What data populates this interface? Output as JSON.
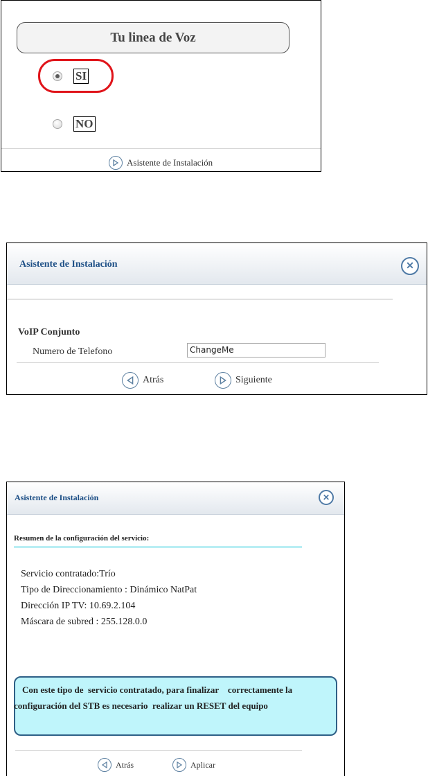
{
  "panel1": {
    "title": "Tu linea de Voz",
    "options": [
      {
        "label": "SI",
        "selected": true
      },
      {
        "label": "NO",
        "selected": false
      }
    ],
    "footer_link": "Asistente de Instalación",
    "highlight_color": "#e0141a"
  },
  "panel2": {
    "title": "Asistente de Instalación",
    "section": "VoIP Conjunto",
    "phone_label": "Numero de Telefono",
    "phone_value": "ChangeMe",
    "back_label": "Atrás",
    "next_label": "Siguiente"
  },
  "panel3": {
    "title": "Asistente de Instalación",
    "summary_heading": "Resumen de la configuración del servicio:",
    "lines": [
      "Servicio contratado:Trío",
      "Tipo de Direccionamiento : Dinámico NatPat",
      "Dirección IP TV: 10.69.2.104",
      "Máscara de subred : 255.128.0.0"
    ],
    "notice_line1": "Con este tipo de  servicio contratado, para finalizar    correctamente la",
    "notice_line2": "configuración del STB es necesario  realizar un RESET del equipo",
    "back_label": "Atrás",
    "apply_label": "Aplicar"
  },
  "colors": {
    "header_title": "#1d4f86",
    "notice_bg": "#bff5fb",
    "notice_border": "#2e5f86",
    "progress_bar": "#b9eef4"
  }
}
